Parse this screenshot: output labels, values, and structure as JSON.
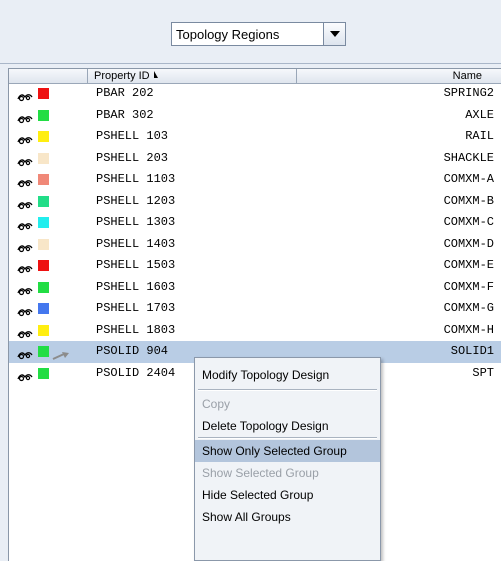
{
  "dropdown": {
    "selected": "Topology Regions"
  },
  "table": {
    "columns": [
      "Property ID",
      "Name"
    ],
    "rows": [
      {
        "id": "PBAR 202",
        "name": "SPRING2",
        "color": "#ee1111"
      },
      {
        "id": "PBAR 302",
        "name": "AXLE",
        "color": "#22dd44"
      },
      {
        "id": "PSHELL 103",
        "name": "RAIL",
        "color": "#ffee11"
      },
      {
        "id": "PSHELL 203",
        "name": "SHACKLE",
        "color": "#f8e6c8"
      },
      {
        "id": "PSHELL 1103",
        "name": "COMXM-A",
        "color": "#f08878"
      },
      {
        "id": "PSHELL 1203",
        "name": "COMXM-B",
        "color": "#22dd88"
      },
      {
        "id": "PSHELL 1303",
        "name": "COMXM-C",
        "color": "#22eeee"
      },
      {
        "id": "PSHELL 1403",
        "name": "COMXM-D",
        "color": "#f8e6c8"
      },
      {
        "id": "PSHELL 1503",
        "name": "COMXM-E",
        "color": "#ee1111"
      },
      {
        "id": "PSHELL 1603",
        "name": "COMXM-F",
        "color": "#22dd44"
      },
      {
        "id": "PSHELL 1703",
        "name": "COMXM-G",
        "color": "#4477ee"
      },
      {
        "id": "PSHELL 1803",
        "name": "COMXM-H",
        "color": "#ffee11"
      },
      {
        "id": "PSOLID 904",
        "name": "SOLID1",
        "color": "#22dd44",
        "selected": true
      },
      {
        "id": "PSOLID 2404",
        "name": "SPT",
        "color": "#22dd44"
      }
    ]
  },
  "context_menu": {
    "items": [
      {
        "label": "Modify Topology Design",
        "disabled": false
      },
      {
        "label": "Copy",
        "disabled": true
      },
      {
        "label": "Delete Topology Design",
        "disabled": false
      },
      {
        "label": "Show Only Selected Group",
        "disabled": false,
        "highlighted": true
      },
      {
        "label": "Show Selected Group",
        "disabled": true
      },
      {
        "label": "Hide Selected Group",
        "disabled": false
      },
      {
        "label": "Show All Groups",
        "disabled": false
      }
    ]
  }
}
